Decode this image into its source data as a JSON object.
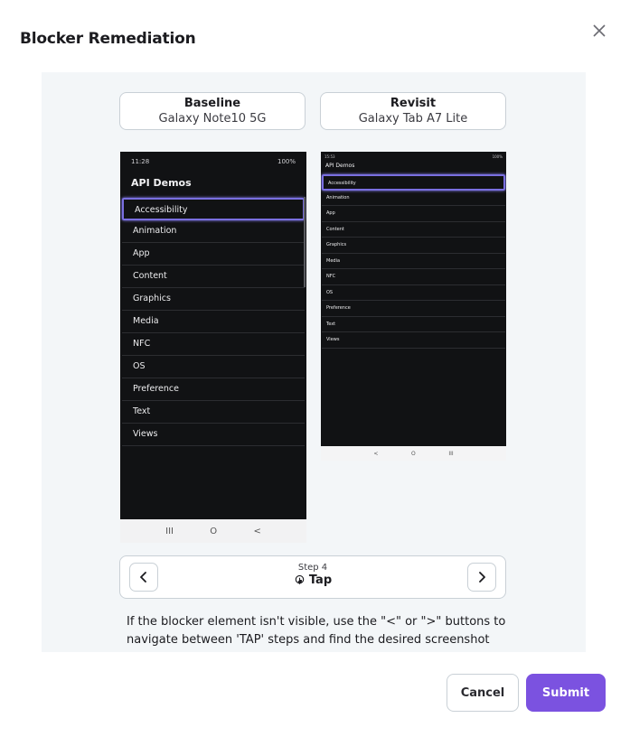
{
  "modal": {
    "title": "Blocker Remediation"
  },
  "baseline": {
    "label": "Baseline",
    "device": "Galaxy Note10 5G",
    "status_time": "11:28",
    "status_right": "100%",
    "app_title": "API Demos",
    "items": [
      "Accessibility",
      "Animation",
      "App",
      "Content",
      "Graphics",
      "Media",
      "NFC",
      "OS",
      "Preference",
      "Text",
      "Views"
    ],
    "nav": [
      "III",
      "O",
      "<"
    ]
  },
  "revisit": {
    "label": "Revisit",
    "device": "Galaxy Tab A7 Lite",
    "status_time": "15:53",
    "status_right": "100%",
    "app_title": "API Demos",
    "items": [
      "Accessibility",
      "Animation",
      "App",
      "Content",
      "Graphics",
      "Media",
      "NFC",
      "OS",
      "Preference",
      "Text",
      "Views"
    ],
    "nav": [
      "<",
      "O",
      "III"
    ]
  },
  "stepper": {
    "step_label": "Step 4",
    "action": "Tap",
    "prev_icon": "chevron-left-icon",
    "next_icon": "chevron-right-icon",
    "action_icon": "tap-icon"
  },
  "help_text": "If the blocker element isn't visible, use the \"<\" or \">\" buttons to navigate between 'TAP' steps and find the desired screenshot for remediation.",
  "actions": {
    "cancel": "Cancel",
    "submit": "Submit"
  },
  "colors": {
    "accent": "#7b52e0",
    "highlight": "#7a6fe0",
    "panel": "#f3f6f8"
  }
}
